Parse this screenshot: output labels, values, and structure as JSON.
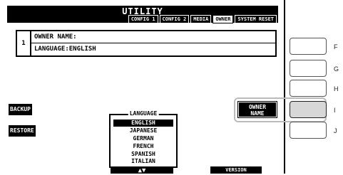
{
  "window": {
    "title": "UTILITY"
  },
  "tabs": [
    {
      "label": "CONFIG 1",
      "active": false
    },
    {
      "label": "CONFIG 2",
      "active": false
    },
    {
      "label": "MEDIA",
      "active": false
    },
    {
      "label": "OWNER",
      "active": true
    },
    {
      "label": "SYSTEM RESET",
      "active": false
    }
  ],
  "list": {
    "number": "1",
    "rows": [
      "OWNER NAME:",
      "LANGUAGE:ENGLISH"
    ]
  },
  "side_buttons": {
    "backup": "BACKUP",
    "restore": "RESTORE"
  },
  "owner_name_label": {
    "line1": "OWNER",
    "line2": "NAME"
  },
  "language": {
    "legend": "LANGUAGE",
    "options": [
      "ENGLISH",
      "JAPANESE",
      "GERMAN",
      "FRENCH",
      "SPANISH",
      "ITALIAN"
    ],
    "selected": "ENGLISH"
  },
  "bottom": {
    "arrows": "▲▼",
    "version": "VERSION"
  },
  "hardware_buttons": [
    {
      "letter": "F",
      "pressed": false
    },
    {
      "letter": "G",
      "pressed": false
    },
    {
      "letter": "H",
      "pressed": false
    },
    {
      "letter": "I",
      "pressed": true
    },
    {
      "letter": "J",
      "pressed": false
    }
  ]
}
